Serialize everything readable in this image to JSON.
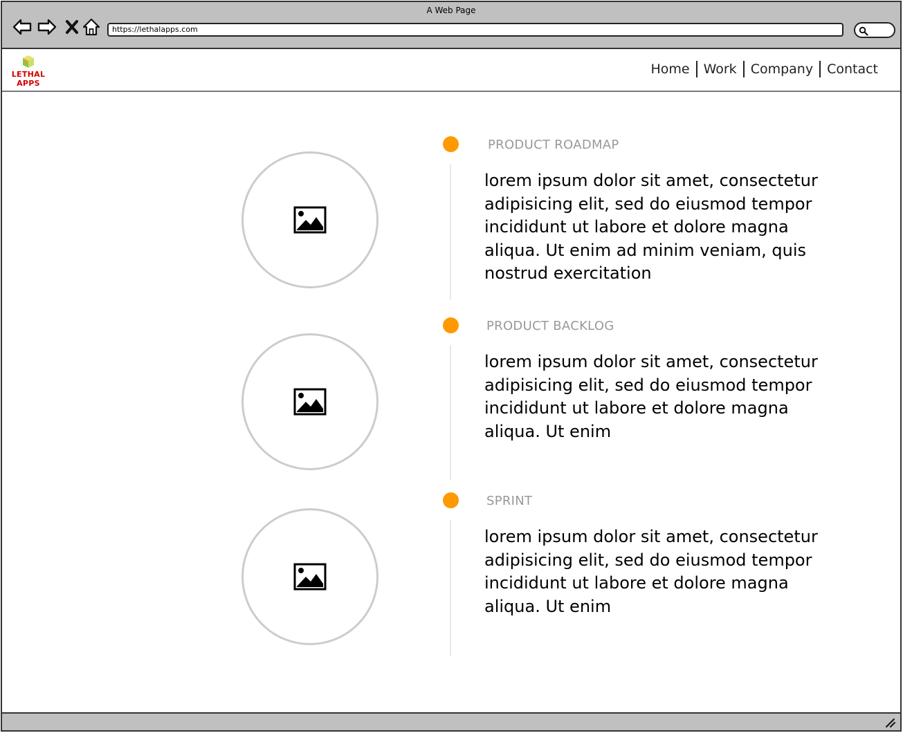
{
  "window": {
    "title": "A Web Page",
    "url": "https://lethalapps.com"
  },
  "icons": {
    "back": "back-arrow-icon",
    "forward": "forward-arrow-icon",
    "close": "close-icon",
    "home": "home-icon",
    "search": "search-icon",
    "image": "image-placeholder-icon",
    "resize": "resize-grip-icon"
  },
  "brand": {
    "logo_line1": "LETHAL",
    "logo_line2": "APPS"
  },
  "nav": {
    "items": [
      {
        "label": "Home"
      },
      {
        "label": "Work"
      },
      {
        "label": "Company"
      },
      {
        "label": "Contact"
      }
    ]
  },
  "timeline": {
    "steps": [
      {
        "title": "PRODUCT ROADMAP",
        "text": "lorem ipsum dolor sit amet, consectetur adipisicing elit, sed do eiusmod tempor incididunt ut labore et dolore magna aliqua. Ut enim ad minim veniam, quis nostrud exercitation"
      },
      {
        "title": "PRODUCT BACKLOG",
        "text": "lorem ipsum dolor sit amet, consectetur adipisicing elit, sed do eiusmod tempor incididunt ut labore et dolore magna aliqua. Ut enim"
      },
      {
        "title": "SPRINT",
        "text": "lorem ipsum dolor sit amet, consectetur adipisicing elit, sed do eiusmod tempor incididunt ut labore et dolore magna aliqua. Ut enim"
      }
    ]
  },
  "colors": {
    "accent": "#ff9900",
    "chrome": "#c0c0c0",
    "logo_red": "#d00000",
    "muted_title": "#999999"
  }
}
